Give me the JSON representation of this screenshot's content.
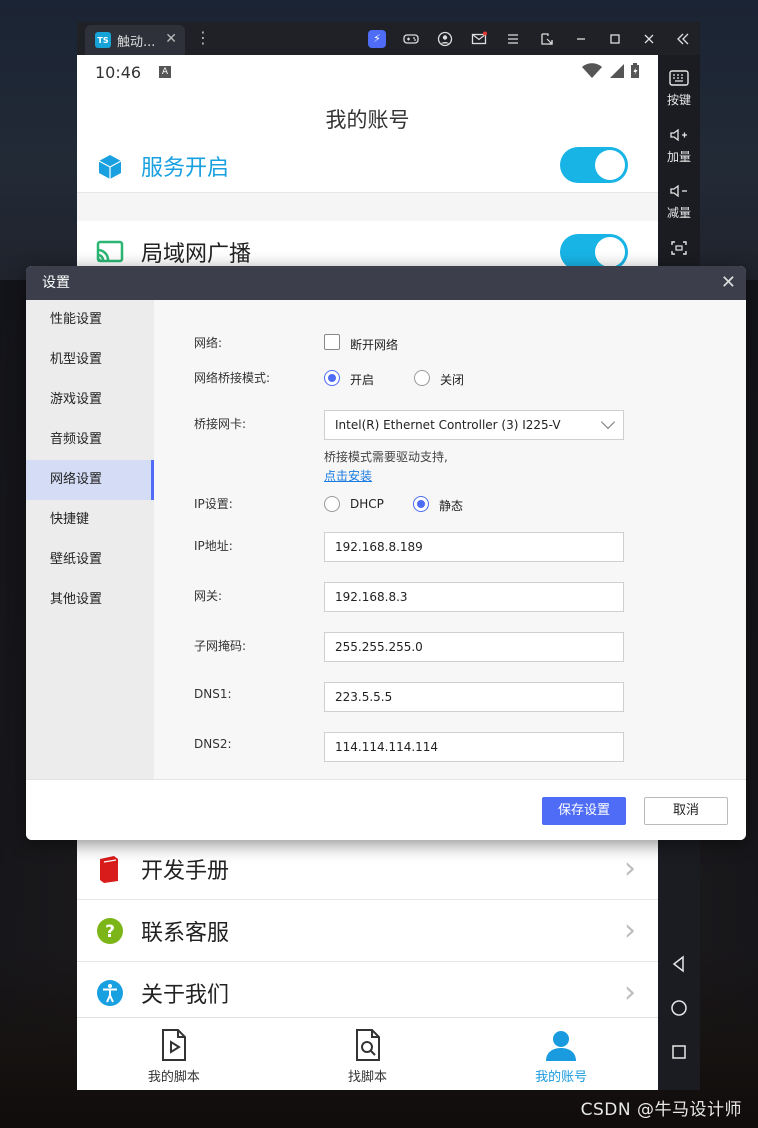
{
  "emulator": {
    "tab_title": "触动...",
    "sidebar": [
      "按键",
      "加量",
      "减量"
    ]
  },
  "phone": {
    "time": "10:46",
    "page_title": "我的账号",
    "rows_top": [
      {
        "label": "服务开启",
        "toggle": true
      },
      {
        "label": "局域网广播",
        "toggle": true
      }
    ],
    "rows_bottom": [
      {
        "label": "开发手册"
      },
      {
        "label": "联系客服"
      },
      {
        "label": "关于我们"
      }
    ],
    "nav": [
      {
        "label": "我的脚本",
        "active": false
      },
      {
        "label": "找脚本",
        "active": false
      },
      {
        "label": "我的账号",
        "active": true
      }
    ]
  },
  "dialog": {
    "title": "设置",
    "nav": [
      "性能设置",
      "机型设置",
      "游戏设置",
      "音频设置",
      "网络设置",
      "快捷键",
      "壁纸设置",
      "其他设置"
    ],
    "selected_nav": "网络设置",
    "network": {
      "network_label": "网络:",
      "disconnect_label": "断开网络",
      "bridge_label": "网络桥接模式:",
      "bridge_on": "开启",
      "bridge_off": "关闭",
      "nic_label": "桥接网卡:",
      "nic_value": "Intel(R) Ethernet Controller (3) I225-V",
      "driver_note": "桥接模式需要驱动支持,",
      "install_link": "点击安装",
      "ip_setting_label": "IP设置:",
      "dhcp": "DHCP",
      "static": "静态",
      "ip_label": "IP地址:",
      "ip_value": "192.168.8.189",
      "gateway_label": "网关:",
      "gateway_value": "192.168.8.3",
      "mask_label": "子网掩码:",
      "mask_value": "255.255.255.0",
      "dns1_label": "DNS1:",
      "dns1_value": "223.5.5.5",
      "dns2_label": "DNS2:",
      "dns2_value": "114.114.114.114"
    },
    "save_label": "保存设置",
    "cancel_label": "取消"
  },
  "watermark": "CSDN @牛马设计师",
  "colors": {
    "accent": "#4e6cf5",
    "toggle": "#18b4e6",
    "dialog_header": "#3c3f4b"
  }
}
